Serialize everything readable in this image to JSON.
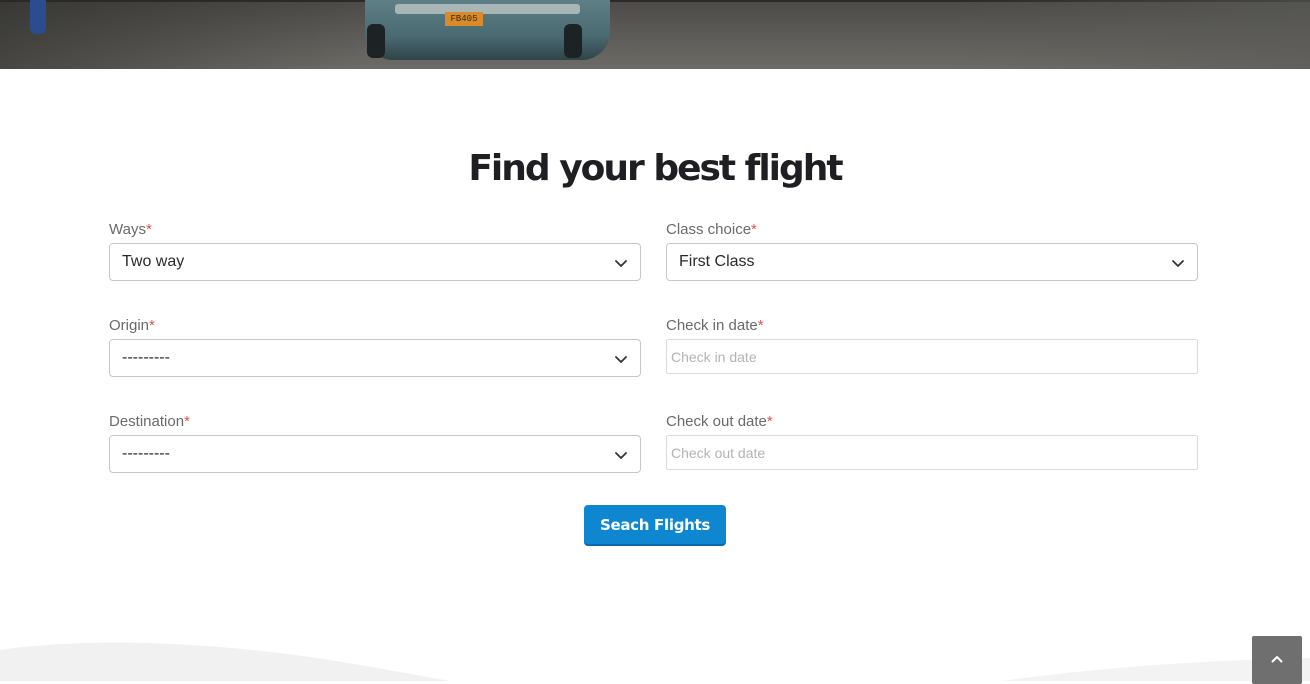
{
  "hero": {
    "plate_text": "FB405"
  },
  "heading": "Find your best flight",
  "form": {
    "ways": {
      "label": "Ways",
      "required": "*",
      "value": "Two way"
    },
    "class_choice": {
      "label": "Class choice",
      "required": "*",
      "value": "First Class"
    },
    "origin": {
      "label": "Origin",
      "required": "*",
      "value": "---------"
    },
    "check_in": {
      "label": "Check in date",
      "required": "*",
      "placeholder": "Check in date"
    },
    "destination": {
      "label": "Destination",
      "required": "*",
      "value": "---------"
    },
    "check_out": {
      "label": "Check out date",
      "required": "*",
      "placeholder": "Check out date"
    },
    "submit_label": "Seach Flights"
  },
  "icons": {
    "dropdown": "chevron-down-icon",
    "back_to_top": "chevron-up-icon"
  },
  "colors": {
    "primary_button": "#0e87d0",
    "required_mark": "#e05252",
    "heading": "#1f1f23"
  }
}
